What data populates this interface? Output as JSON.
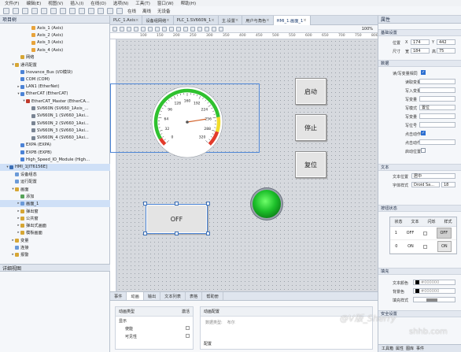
{
  "menu": [
    "文件(F)",
    "编辑(E)",
    "视图(V)",
    "插入(I)",
    "在线(O)",
    "选项(N)",
    "工具(T)",
    "窗口(W)",
    "帮助(H)"
  ],
  "toolbar": {
    "online_label": "在线",
    "offline_label": "离线",
    "status_label": "无设备"
  },
  "left_panel": {
    "title": "项目树",
    "second_title": "详细视图",
    "tree": [
      {
        "label": "Axis_1 (Axis)",
        "indent": 5,
        "color": "#e8a33a",
        "expand": ""
      },
      {
        "label": "Axis_2 (Axis)",
        "indent": 5,
        "color": "#e8a33a",
        "expand": ""
      },
      {
        "label": "Axis_3 (Axis)",
        "indent": 5,
        "color": "#e8a33a",
        "expand": ""
      },
      {
        "label": "Axis_4 (Axis)",
        "indent": 5,
        "color": "#e8a33a",
        "expand": ""
      },
      {
        "label": "网络",
        "indent": 3,
        "color": "#d6a634",
        "expand": ""
      },
      {
        "label": "通讯配置",
        "indent": 2,
        "color": "#d6a634",
        "expand": "▾"
      },
      {
        "label": "Inovance_Bus (I/O模块)",
        "indent": 3,
        "color": "#4c83d6",
        "expand": ""
      },
      {
        "label": "COM (COM)",
        "indent": 3,
        "color": "#4c83d6",
        "expand": ""
      },
      {
        "label": "LAN1 (EtherNet)",
        "indent": 3,
        "color": "#4c83d6",
        "expand": "▸"
      },
      {
        "label": "EtherCAT (EtherCAT)",
        "indent": 3,
        "color": "#4c83d6",
        "expand": "▾"
      },
      {
        "label": "EtherCAT_Master (EtherCA...",
        "indent": 4,
        "color": "#c0392b",
        "expand": "▾"
      },
      {
        "label": "SV660N (SV660_1Axis_...",
        "indent": 5,
        "color": "#7a8594",
        "expand": ""
      },
      {
        "label": "SV660N_1 (SV660_1Axi...",
        "indent": 5,
        "color": "#7a8594",
        "expand": ""
      },
      {
        "label": "SV660N_2 (SV660_1Axi...",
        "indent": 5,
        "color": "#7a8594",
        "expand": ""
      },
      {
        "label": "SV660N_3 (SV660_1Axi...",
        "indent": 5,
        "color": "#7a8594",
        "expand": ""
      },
      {
        "label": "SV660N_4 (SV660_1Axi...",
        "indent": 5,
        "color": "#7a8594",
        "expand": ""
      },
      {
        "label": "EXPA (EXPA)",
        "indent": 3,
        "color": "#4c83d6",
        "expand": ""
      },
      {
        "label": "EXPB (EXPB)",
        "indent": 3,
        "color": "#4c83d6",
        "expand": ""
      },
      {
        "label": "High_Speed_IO_Module (High...",
        "indent": 3,
        "color": "#4c83d6",
        "expand": ""
      },
      {
        "label": "HMI_1[IT6156E]",
        "indent": 1,
        "color": "#3b6fb6",
        "expand": "▾",
        "selected": true
      },
      {
        "label": "设备组态",
        "indent": 2,
        "color": "#6b9ad8",
        "expand": ""
      },
      {
        "label": "运行配置",
        "indent": 2,
        "color": "#6b9ad8",
        "expand": ""
      },
      {
        "label": "画面",
        "indent": 2,
        "color": "#d6a634",
        "expand": "▾"
      },
      {
        "label": "添加",
        "indent": 3,
        "color": "#56a35a",
        "expand": ""
      },
      {
        "label": "画面_1",
        "indent": 3,
        "color": "#6b9ad8",
        "expand": "▸",
        "selected": true
      },
      {
        "label": "弹出窗",
        "indent": 3,
        "color": "#d6a634",
        "expand": "▸"
      },
      {
        "label": "公共窗",
        "indent": 3,
        "color": "#d6a634",
        "expand": "▸"
      },
      {
        "label": "弹出式画面",
        "indent": 3,
        "color": "#d6a634",
        "expand": "▸"
      },
      {
        "label": "模板画面",
        "indent": 3,
        "color": "#d6a634",
        "expand": "▸"
      },
      {
        "label": "变量",
        "indent": 2,
        "color": "#d6a634",
        "expand": "▸"
      },
      {
        "label": "连接",
        "indent": 2,
        "color": "#6b9ad8",
        "expand": ""
      },
      {
        "label": "报警",
        "indent": 2,
        "color": "#d6a634",
        "expand": "▸"
      }
    ]
  },
  "tabs": [
    {
      "label": "PLC_1.Axis",
      "active": false
    },
    {
      "label": "设备组网络",
      "active": false
    },
    {
      "label": "PLC_1.SV660N_1",
      "active": false
    },
    {
      "label": "主.设置",
      "active": false
    },
    {
      "label": "用户与角色",
      "active": false
    },
    {
      "label": "HMI_1.画面_1",
      "active": true
    }
  ],
  "zoom": "100%",
  "ruler_ticks": [
    "100",
    "150",
    "200",
    "250",
    "300",
    "350",
    "400",
    "450",
    "500",
    "550",
    "600",
    "650",
    "700",
    "750",
    "800"
  ],
  "gauge": {
    "ticks": [
      "0",
      "32",
      "64",
      "96",
      "128",
      "160",
      "192",
      "224",
      "256",
      "288",
      "320"
    ],
    "max": 320,
    "value": 256
  },
  "buttons": {
    "start": "启动",
    "stop": "停止",
    "reset": "复位",
    "toggle": "OFF"
  },
  "bottom_panel": {
    "tabs": [
      "事件",
      "动画",
      "输出",
      "文本列表",
      "表格",
      "帮助册"
    ],
    "active_tab": "动画",
    "col_type": "动画类型",
    "col_state": "激活",
    "rows": [
      "显示",
      "使能",
      "可见性"
    ],
    "right_header": "动画配置",
    "right_label1": "数据类型:",
    "right_value1": "布尔",
    "right_section2": "配置"
  },
  "right_panel": {
    "title": "属性",
    "sections": {
      "geometry": "基础设置",
      "data": "数据",
      "text": "文本",
      "states": "按钮状态",
      "fill": "填充",
      "security": "安全设置"
    },
    "pos_label": "位置",
    "x_label": "X",
    "x_value": "174",
    "y_label": "Y",
    "y_value": "442",
    "size_label": "尺寸",
    "w_label": "宽",
    "w_value": "184",
    "h_label": "高",
    "h_value": "75",
    "data_rows": [
      "读/写变量相同",
      "读取变量",
      "写入变量",
      "写变量",
      "写模式",
      "写变量",
      "写位号",
      "点击动作",
      "点击动作延时",
      "启动位置"
    ],
    "write_mode_value": "置位",
    "text_rows": [
      "文本位置",
      "字体样式"
    ],
    "text_align": "居中",
    "font_name": "Droid Sa...",
    "font_size": "18",
    "state_cols": [
      "状态",
      "文本",
      "闪烁",
      "样式"
    ],
    "state_rows": [
      {
        "state": "1",
        "text": "OFF",
        "style": "OFF"
      },
      {
        "state": "0",
        "text": "ON",
        "style": "ON"
      }
    ],
    "fill_rows": [
      "文本颜色",
      "背景色",
      "填充样式"
    ],
    "color1": "#000000",
    "color2": "#000000",
    "bottom_tabs": [
      "工具箱",
      "属性",
      "图库",
      "事件"
    ]
  },
  "watermark": "@V版_Sherry",
  "watermark2": "shhb.com",
  "colors": {
    "accent": "#2c6fd1",
    "green_led": "#1cbf2a",
    "gauge_green": "#2fc12f",
    "gauge_yellow": "#f1dc2a",
    "gauge_red": "#e23b2b"
  }
}
